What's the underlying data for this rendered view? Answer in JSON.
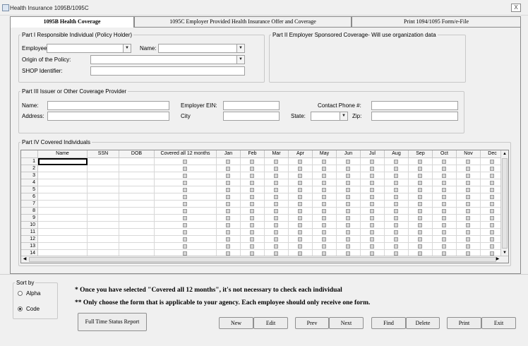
{
  "window": {
    "title": "Health Insurance 1095B/1095C",
    "close": "X"
  },
  "tabs": [
    {
      "label": "1095B Health Coverage"
    },
    {
      "label": "1095C Employer Provided Health Insurance Offer and Coverage"
    },
    {
      "label": "Print 1094/1095 Form/e-File"
    }
  ],
  "part1": {
    "legend": "Part I Responsible Individual (Policy Holder)",
    "employee_label": "Employee:",
    "name_label": "Name:",
    "origin_label": "Origin of the Policy:",
    "shop_label": "SHOP Identifier:"
  },
  "part2": {
    "legend": "Part II Employer Sponsored Coverage- Will use organization data"
  },
  "part3": {
    "legend": "Part III Issuer or Other Coverage Provider",
    "name_label": "Name:",
    "address_label": "Address:",
    "ein_label": "Employer EIN:",
    "city_label": "City",
    "phone_label": "Contact Phone #:",
    "state_label": "State:",
    "zip_label": "Zip:"
  },
  "part4": {
    "legend": "Part IV Covered Individuals",
    "columns": [
      "Name",
      "SSN",
      "DOB",
      "Covered all 12 months",
      "Jan",
      "Feb",
      "Mar",
      "Apr",
      "May",
      "Jun",
      "Jul",
      "Aug",
      "Sep",
      "Oct",
      "Nov",
      "Dec"
    ],
    "rows": [
      "1",
      "2",
      "3",
      "4",
      "5",
      "6",
      "7",
      "8",
      "9",
      "10",
      "11",
      "12",
      "13",
      "14"
    ]
  },
  "sort": {
    "legend": "Sort by",
    "options": [
      {
        "label": "Alpha",
        "selected": false
      },
      {
        "label": "Code",
        "selected": true
      }
    ]
  },
  "notes": {
    "line1": "* Once you have selected \"Covered all 12 months\", it's not necessary to check each individual",
    "line2": "** Only choose the form that is applicable to your agency. Each employee should only receive one form."
  },
  "buttons": {
    "report": "Full Time Status Report",
    "new": "New",
    "edit": "Edit",
    "prev": "Prev",
    "next": "Next",
    "find": "Find",
    "delete": "Delete",
    "print": "Print",
    "exit": "Exit"
  }
}
